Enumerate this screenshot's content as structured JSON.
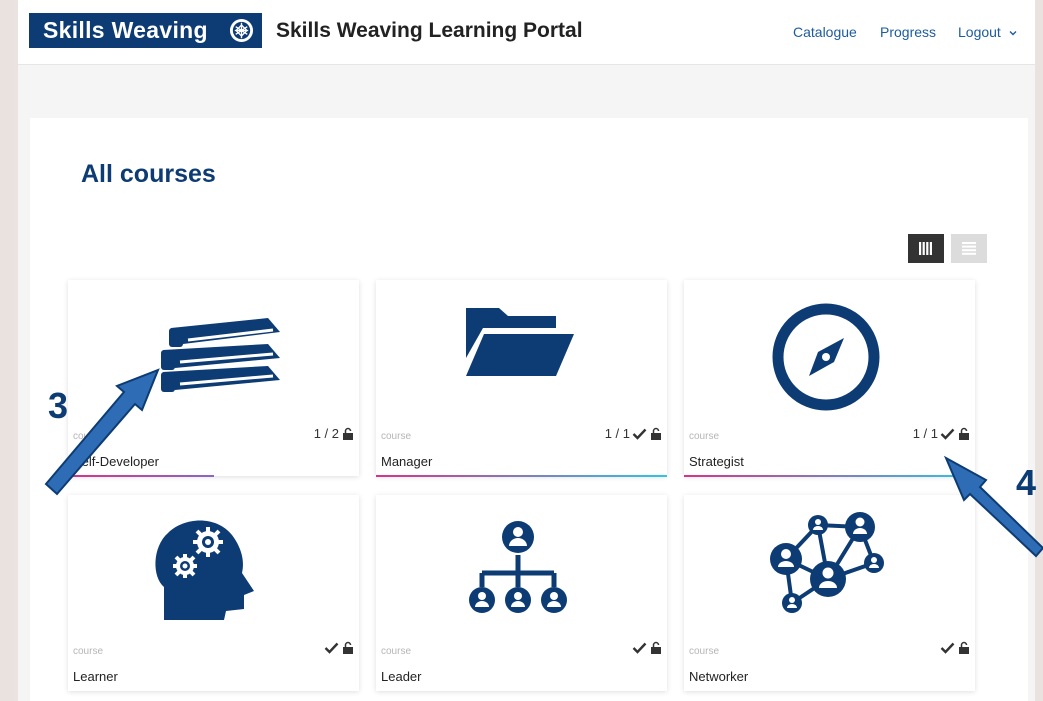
{
  "header": {
    "logo_text": "Skills Weaving",
    "site_title": "Skills Weaving Learning Portal",
    "nav": [
      {
        "label": "Catalogue"
      },
      {
        "label": "Progress"
      },
      {
        "label": "Logout"
      }
    ]
  },
  "main": {
    "heading": "All courses"
  },
  "courses": [
    {
      "type": "course",
      "name": "Self-Developer",
      "progress_text": "1 / 2",
      "completed": false,
      "progress": 0.5
    },
    {
      "type": "course",
      "name": "Manager",
      "progress_text": "1 / 1",
      "completed": true,
      "progress": 1
    },
    {
      "type": "course",
      "name": "Strategist",
      "progress_text": "1 / 1",
      "completed": true,
      "progress": 1
    },
    {
      "type": "course",
      "name": "Learner",
      "progress_text": "",
      "completed": true,
      "progress": 0
    },
    {
      "type": "course",
      "name": "Leader",
      "progress_text": "",
      "completed": true,
      "progress": 0
    },
    {
      "type": "course",
      "name": "Networker",
      "progress_text": "",
      "completed": true,
      "progress": 0
    }
  ],
  "annotations": [
    {
      "label": "3"
    },
    {
      "label": "4"
    }
  ],
  "colors": {
    "brand": "#0d3b73",
    "nav_link": "#1d5c9c",
    "progress_start": "#d6338a",
    "progress_end": "#2ec5e6"
  }
}
